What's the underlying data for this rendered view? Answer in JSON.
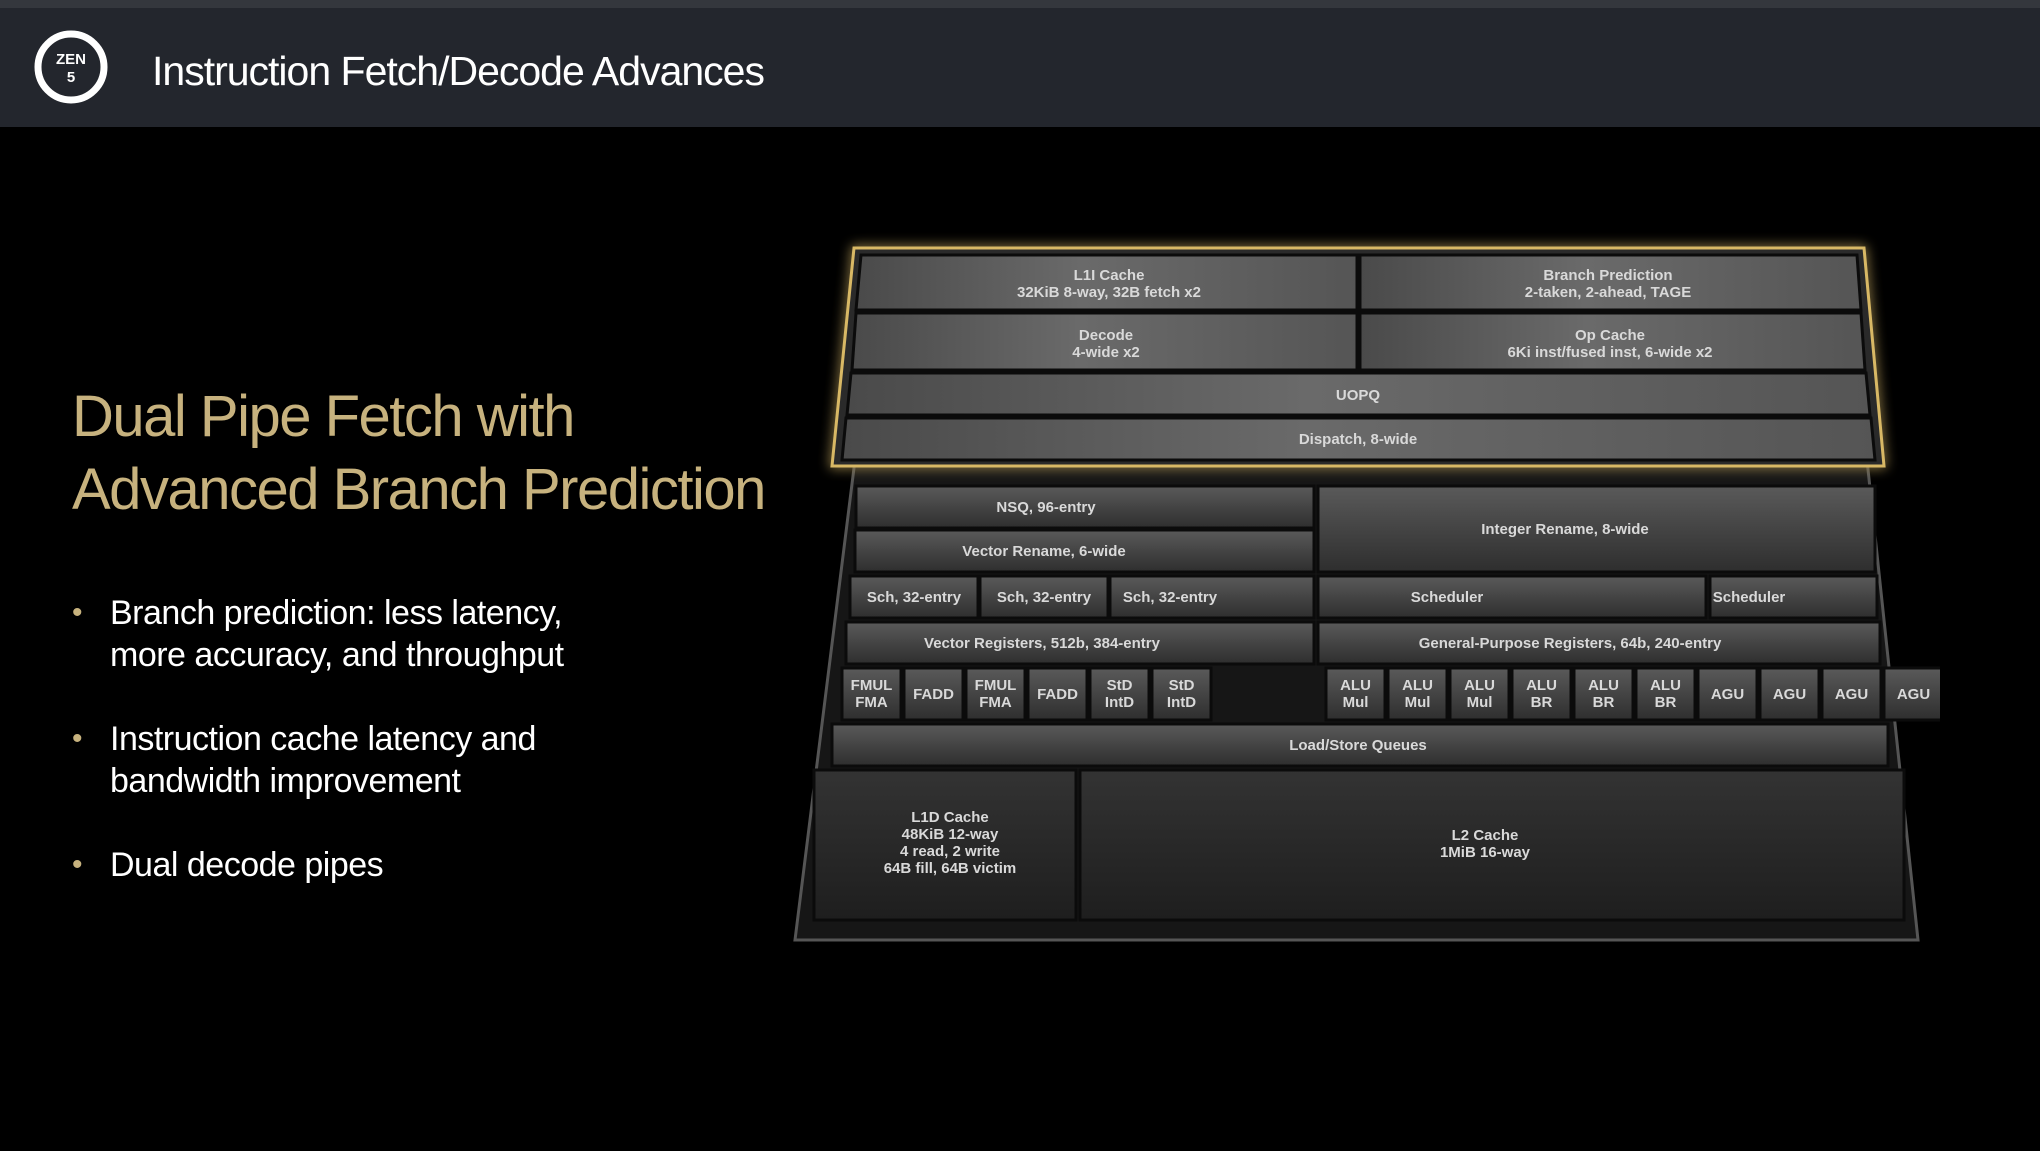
{
  "header": {
    "title": "Instruction Fetch/Decode Advances",
    "logo": {
      "text_top": "ZEN",
      "text_bottom": "5",
      "icon": "zen5-logo"
    }
  },
  "headline": [
    "Dual Pipe Fetch with",
    "Advanced Branch Prediction"
  ],
  "bullets": [
    [
      "Branch prediction: less latency,",
      "more accuracy, and throughput"
    ],
    [
      "Instruction cache latency and",
      "bandwidth improvement"
    ],
    [
      "Dual decode pipes"
    ]
  ],
  "colors": {
    "accent_gold": "#c7b27e",
    "header_bg": "#23262d",
    "background": "#000000"
  },
  "diagram": {
    "frontend": {
      "l1i": [
        "L1I Cache",
        "32KiB 8-way, 32B fetch x2"
      ],
      "branch": [
        "Branch Prediction",
        "2-taken, 2-ahead, TAGE"
      ],
      "decode": [
        "Decode",
        "4-wide x2"
      ],
      "opcache": [
        "Op Cache",
        "6Ki inst/fused inst, 6-wide x2"
      ],
      "uopq": "UOPQ",
      "dispatch": "Dispatch, 8-wide"
    },
    "vector": {
      "nsq": "NSQ, 96-entry",
      "rename": "Vector Rename, 6-wide",
      "schedulers": [
        "Sch, 32-entry",
        "Sch, 32-entry",
        "Sch, 32-entry"
      ],
      "registers": "Vector Registers, 512b, 384-entry",
      "units": [
        [
          "FMUL",
          "FMA"
        ],
        [
          "FADD"
        ],
        [
          "FMUL",
          "FMA"
        ],
        [
          "FADD"
        ],
        [
          "StD",
          "IntD"
        ],
        [
          "StD",
          "IntD"
        ]
      ]
    },
    "integer": {
      "rename": "Integer Rename, 8-wide",
      "schedulers": [
        "Scheduler",
        "Scheduler"
      ],
      "registers": "General-Purpose Registers, 64b, 240-entry",
      "units": [
        [
          "ALU",
          "Mul"
        ],
        [
          "ALU",
          "Mul"
        ],
        [
          "ALU",
          "Mul"
        ],
        [
          "ALU",
          "BR"
        ],
        [
          "ALU",
          "BR"
        ],
        [
          "ALU",
          "BR"
        ],
        [
          "AGU"
        ],
        [
          "AGU"
        ],
        [
          "AGU"
        ],
        [
          "AGU"
        ]
      ]
    },
    "memory": {
      "lsq": "Load/Store Queues",
      "l1d": [
        "L1D Cache",
        "48KiB 12-way",
        "4 read, 2 write",
        "64B fill, 64B victim"
      ],
      "l2": [
        "L2 Cache",
        "1MiB 16-way"
      ]
    }
  }
}
